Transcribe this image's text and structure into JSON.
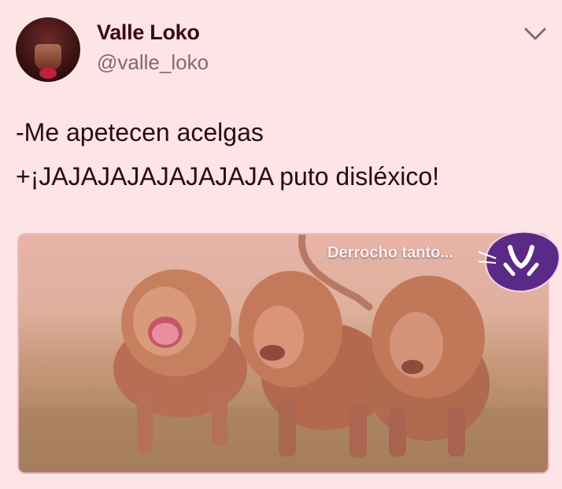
{
  "author": {
    "name": "Valle Loko",
    "handle": "@valle_loko"
  },
  "tweet": {
    "lines": [
      "-Me apetecen acelgas",
      "+¡JAJAJAJAJAJAJAJA puto disléxico!"
    ]
  },
  "media": {
    "watermark": "Derrocho tanto..."
  },
  "icons": {
    "menu": "chevron-down-icon",
    "watermark_logo": "cat-face-icon"
  },
  "colors": {
    "background": "#fde4e6",
    "name": "#3a0814",
    "handle": "#8b6671",
    "logo": "#5b2a86"
  }
}
